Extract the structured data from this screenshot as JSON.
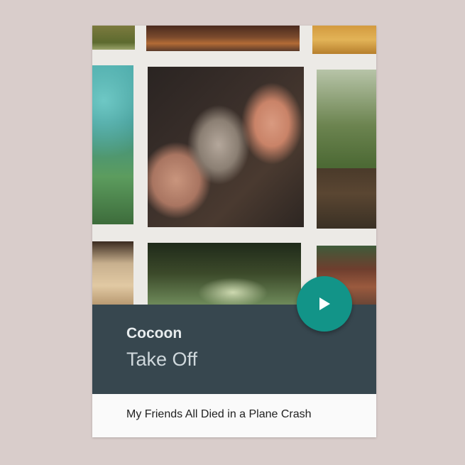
{
  "now_playing": {
    "artist": "Cocoon",
    "track": "Take Off",
    "album": "My Friends All Died in a Plane Crash"
  },
  "play_button": {
    "icon": "play-icon"
  },
  "colors": {
    "background": "#d9cdcb",
    "info_panel": "#37474f",
    "fab": "#129488",
    "album_bar": "#fafafa"
  }
}
